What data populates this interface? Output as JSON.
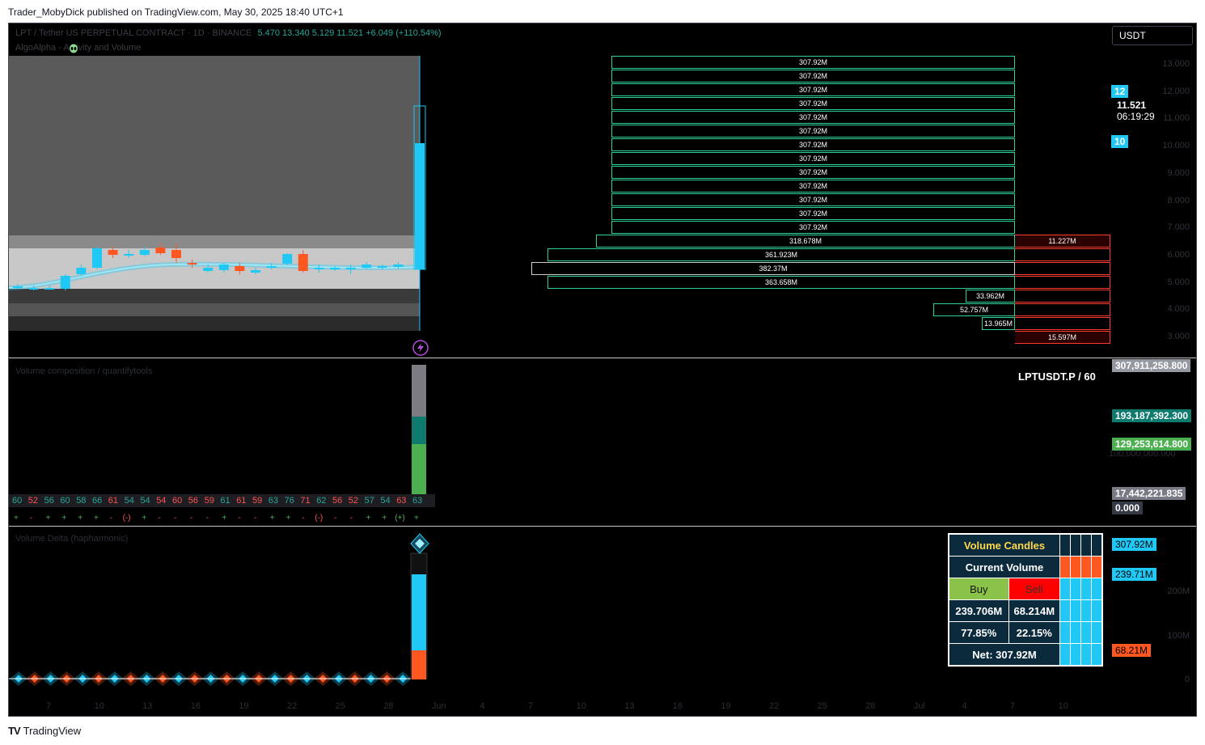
{
  "topbar": {
    "text": "Trader_MobyDick published on TradingView.com, May 30, 2025 18:40 UTC+1"
  },
  "footer": {
    "logo": "TradingView",
    "logo_mark": "TV"
  },
  "legend": {
    "symbol": "LPT / Tether US PERPETUAL CONTRACT · 1D · BINANCE",
    "ohlc": "5.470   13.340   5.129   11.521   +6.049 (+110.54%)",
    "indicator": "AlgoAlpha - Activity and Volume",
    "indicator_icon": "alien-icon"
  },
  "currency": "USDT",
  "price_axis": [
    "13.000",
    "12.000",
    "11.000",
    "10.000",
    "9.000",
    "8.000",
    "7.000",
    "6.000",
    "5.000",
    "4.000",
    "3.000"
  ],
  "price_tags": {
    "p12": "12",
    "current": "11.521",
    "countdown": "06:19:29",
    "p10": "10"
  },
  "volume_profile": {
    "buy_rows": [
      "307.92M",
      "307.92M",
      "307.92M",
      "307.92M",
      "307.92M",
      "307.92M",
      "307.92M",
      "307.92M",
      "307.92M",
      "307.92M",
      "307.92M",
      "307.92M",
      "307.92M",
      "318.678M",
      "361.923M",
      "382.37M",
      "363.658M",
      "33.962M",
      "52.757M",
      "13.965M"
    ],
    "sell_rows": [
      "11.227M",
      "",
      "",
      "",
      "",
      "",
      "",
      "15.597M"
    ]
  },
  "pane2": {
    "title": "Volume composition / quantifytools",
    "symbol_label": "LPTUSDT.P / 60",
    "tags": [
      "307,911,258.800",
      "193,187,392.300",
      "129,253,614.800",
      "17,442,221.835",
      "0.000"
    ],
    "axis_label": "100,000,000.000",
    "numbers": [
      "60",
      "52",
      "56",
      "60",
      "58",
      "66",
      "61",
      "54",
      "54",
      "54",
      "60",
      "56",
      "59",
      "61",
      "61",
      "59",
      "63",
      "76",
      "71",
      "62",
      "56",
      "52",
      "57",
      "54",
      "63",
      "63"
    ],
    "number_colors": [
      "#26a69a",
      "#ff5252",
      "#26a69a",
      "#26a69a",
      "#26a69a",
      "#26a69a",
      "#ff5252",
      "#26a69a",
      "#26a69a",
      "#ff5252",
      "#ff5252",
      "#ff5252",
      "#ff5252",
      "#26a69a",
      "#ff5252",
      "#ff5252",
      "#26a69a",
      "#26a69a",
      "#ff5252",
      "#26a69a",
      "#ff5252",
      "#ff5252",
      "#26a69a",
      "#26a69a",
      "#ff5252",
      "#26a69a"
    ],
    "signals": [
      "+",
      "-",
      "+",
      "+",
      "+",
      "+",
      "-",
      "(-)",
      "+",
      "-",
      "-",
      "-",
      "-",
      "+",
      "-",
      "-",
      "+",
      "+",
      "-",
      "(-)",
      "-",
      "-",
      "+",
      "+",
      "(+)",
      "+"
    ]
  },
  "pane3": {
    "title": "Volume Delta (hapharmonic)",
    "axis": [
      "200M",
      "100M",
      "0"
    ],
    "tags": [
      "307.92M",
      "239.71M",
      "68.21M"
    ]
  },
  "volume_candles": {
    "title": "Volume Candles",
    "current": "Current Volume",
    "buy": "Buy",
    "sell": "Sell",
    "buy_vol": "239.706M",
    "sell_vol": "68.214M",
    "buy_pct": "77.85%",
    "sell_pct": "22.15%",
    "net": "Net: 307.92M"
  },
  "time_axis": [
    "7",
    "10",
    "13",
    "16",
    "19",
    "22",
    "25",
    "28",
    "Jun",
    "4",
    "7",
    "10",
    "13",
    "16",
    "19",
    "22",
    "25",
    "28",
    "Jul",
    "4",
    "7",
    "10"
  ],
  "colors": {
    "buy": "#2fd19a",
    "sell": "#ff3b30",
    "cyan": "#1fc8f5",
    "orange": "#ff5722"
  }
}
